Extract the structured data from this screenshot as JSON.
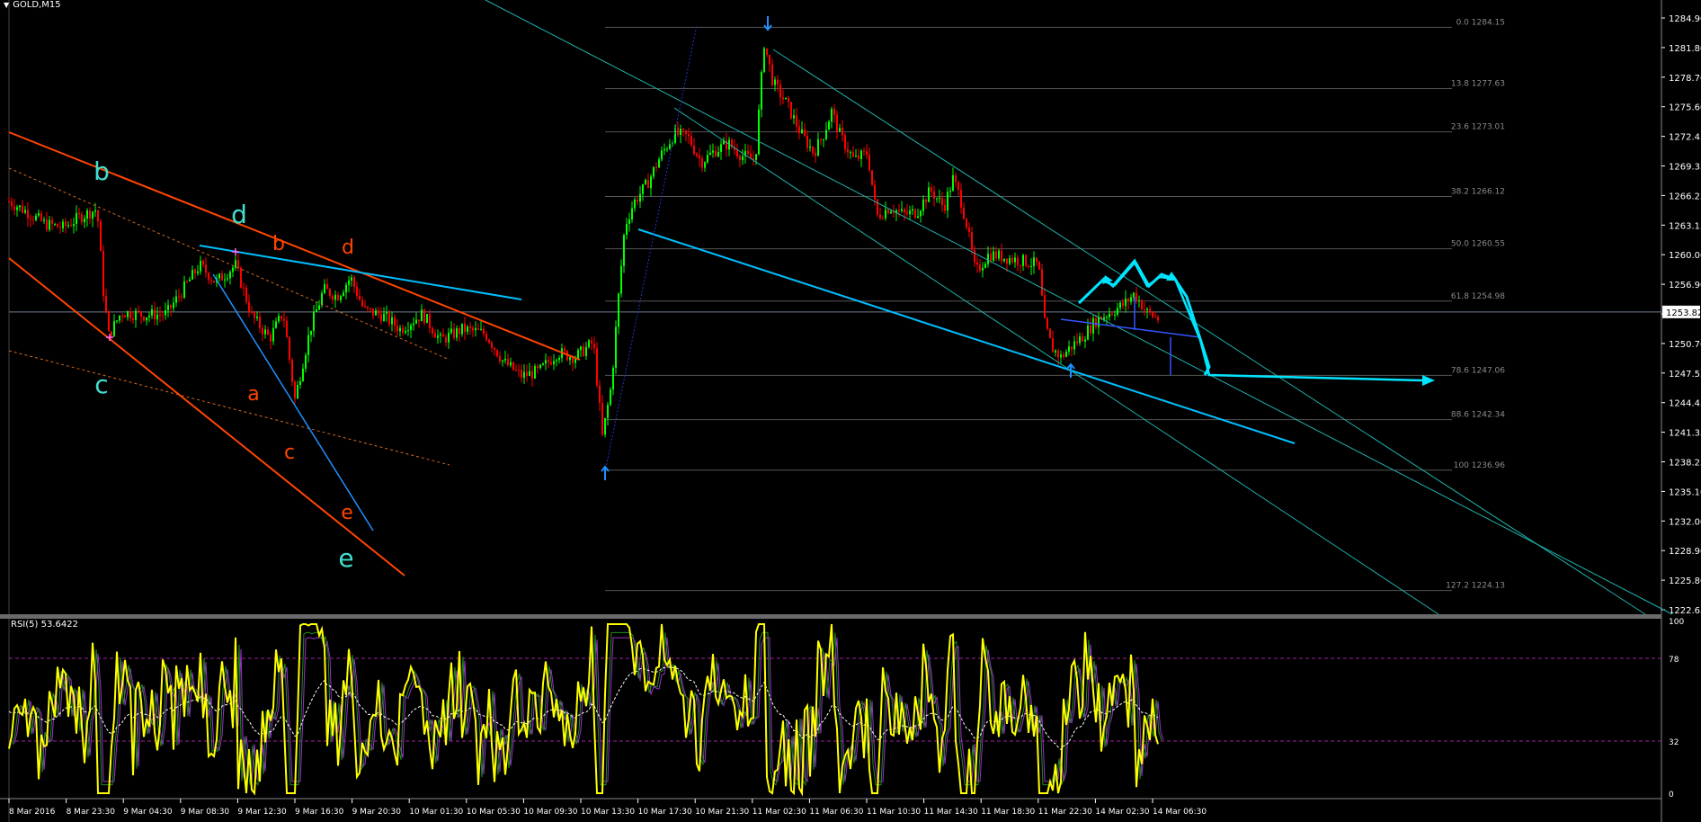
{
  "window": {
    "symbol": "GOLD,M15",
    "menu_icon": "triangle-down-icon"
  },
  "colors": {
    "background": "#000000",
    "bull_candle": "#00ff00",
    "bear_candle": "#ff0000",
    "channel_orange": "#ff4500",
    "trend_blue": "#1e90ff",
    "trend_cyan": "#00bfff",
    "channel_cyan": "#20b2aa",
    "fib_line": "#555555",
    "rsi_yellow": "#ffff00",
    "rsi_level": "#a020a0",
    "bid_line": "#708090"
  },
  "price_axis": {
    "ticks": [
      "1284.90",
      "1281.80",
      "1278.70",
      "1275.60",
      "1272.45",
      "1269.35",
      "1266.25",
      "1263.15",
      "1260.00",
      "1256.90",
      "1253.82",
      "1250.70",
      "1247.55",
      "1244.45",
      "1241.35",
      "1238.25",
      "1235.10",
      "1232.00",
      "1228.90",
      "1225.80",
      "1222.65"
    ],
    "current_price": "1253.82"
  },
  "time_axis": {
    "ticks": [
      "8 Mar 2016",
      "8 Mar 23:30",
      "9 Mar 04:30",
      "9 Mar 08:30",
      "9 Mar 12:30",
      "9 Mar 16:30",
      "9 Mar 20:30",
      "10 Mar 01:30",
      "10 Mar 05:30",
      "10 Mar 09:30",
      "10 Mar 13:30",
      "10 Mar 17:30",
      "10 Mar 21:30",
      "11 Mar 02:30",
      "11 Mar 06:30",
      "11 Mar 10:30",
      "11 Mar 14:30",
      "11 Mar 18:30",
      "11 Mar 22:30",
      "14 Mar 02:30",
      "14 Mar 06:30"
    ]
  },
  "fibonacci": {
    "levels": [
      {
        "label": "0.0 1284.15",
        "price": 1284.15
      },
      {
        "label": "13.8 1277.63",
        "price": 1277.63
      },
      {
        "label": "23.6 1273.01",
        "price": 1273.01
      },
      {
        "label": "38.2 1266.12",
        "price": 1266.12
      },
      {
        "label": "50.0 1260.55",
        "price": 1260.55
      },
      {
        "label": "61.8 1254.98",
        "price": 1254.98
      },
      {
        "label": "78.6 1247.06",
        "price": 1247.06
      },
      {
        "label": "88.6 1242.34",
        "price": 1242.34
      },
      {
        "label": "100 1236.96",
        "price": 1236.96
      },
      {
        "label": "127.2 1224.13",
        "price": 1224.13
      }
    ]
  },
  "wave_labels": {
    "cyan": [
      "b",
      "c",
      "d",
      "e"
    ],
    "orange": [
      "b",
      "d",
      "a",
      "c",
      "e"
    ]
  },
  "rsi": {
    "label": "RSI(5) 53.6422",
    "levels": [
      "100",
      "78",
      "32",
      "0"
    ],
    "level_values": [
      78,
      32
    ]
  }
}
